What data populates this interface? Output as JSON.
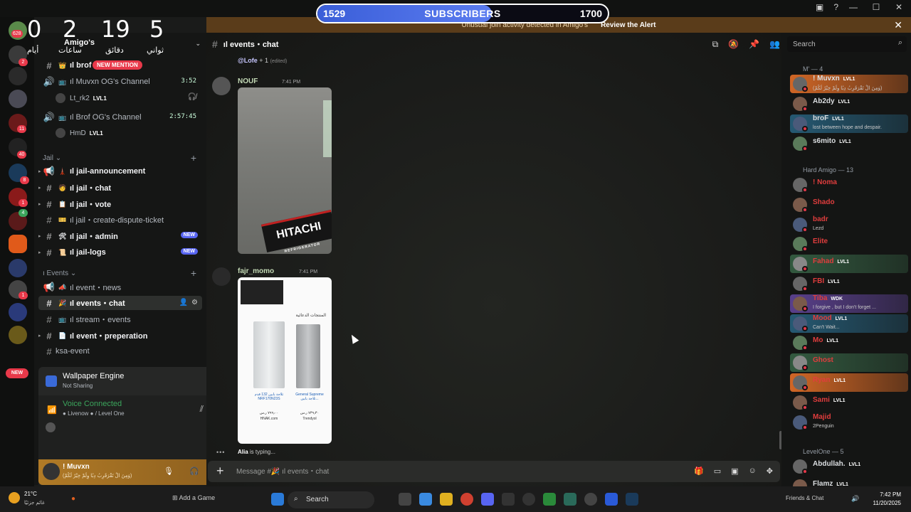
{
  "subscribers": {
    "current": "1529",
    "label": "SUBSCRIBERS",
    "goal": "1700",
    "progress": 0.6
  },
  "countdown": {
    "values": [
      "0",
      "2",
      "19",
      "5"
    ],
    "labels": [
      "أيام",
      "ساعات",
      "دقائق",
      "ثواني"
    ]
  },
  "alert": {
    "text": "Unusual join activity detected in Amigo's",
    "link": "Review the Alert"
  },
  "rail": {
    "top_badge": "628",
    "new_label": "NEW",
    "badges": [
      "2",
      "11",
      "40",
      "8",
      "1",
      "4",
      "1"
    ]
  },
  "server": {
    "name": "Amigo's"
  },
  "sidebar": {
    "mention_pill": "NEW MENTION",
    "channels_top": [
      {
        "label": "ıl brof"
      },
      {
        "label": "ıl Muvxn OG's Channel",
        "time": "3:52"
      },
      {
        "label": "ıl Brof OG's Channel",
        "time": "2:57:45"
      }
    ],
    "voice_users": [
      {
        "name": "Lt_rk2",
        "lvl": "LVL1"
      },
      {
        "name": "HmD",
        "lvl": "LVL1"
      }
    ],
    "jail_category": "Jail",
    "jail_channels": [
      {
        "label": "ıl jail-announcement",
        "emoji": "🗼"
      },
      {
        "label": "ıl jail・chat",
        "emoji": "🧑"
      },
      {
        "label": "ıl jail・vote",
        "emoji": "📋"
      },
      {
        "label": "ıl jail・create-dispute-ticket",
        "emoji": "🎫"
      },
      {
        "label": "ıl jail・admin",
        "emoji": "🛠",
        "tag": "NEW"
      },
      {
        "label": "ıl jail-logs",
        "emoji": "📜",
        "tag": "NEW"
      }
    ],
    "events_category": "ı Events",
    "events_channels": [
      {
        "label": "ıl event・news",
        "emoji": "📣"
      },
      {
        "label": "ıl events・chat",
        "emoji": "🎉"
      },
      {
        "label": "ıl stream・events",
        "emoji": "📺"
      },
      {
        "label": "ıl event・preperation",
        "emoji": "📄"
      },
      {
        "label": "ksa-event",
        "emoji": ""
      }
    ]
  },
  "wallpaper": {
    "title": "Wallpaper Engine",
    "status": "Not Sharing"
  },
  "voice": {
    "title": "Voice Connected",
    "sub1": "Livenow",
    "sub2": "/ Level One"
  },
  "user": {
    "name": "! Muvxn",
    "status": "(وَمِنَ الْ تَقْرَقَرِبُ دِبُا وِلَمْ خِيْرٌ لَكُمْ)"
  },
  "chat": {
    "channel": "ıl events・chat",
    "lofe": {
      "name": "@Lofe",
      "plus": "+ 1",
      "edited": "(edited)"
    },
    "messages": [
      {
        "author": "NOUF",
        "time": "7:41 PM"
      },
      {
        "author": "fajr_momo",
        "time": "7:41 PM"
      }
    ],
    "fridge_brand": "HITACHI",
    "fridge_sub": "REFRIGERATOR",
    "shop": {
      "heading": "المنتجات الدعائية",
      "items": [
        {
          "caption": "ثلاجة بابين 132 قدم NRF170N23S",
          "price": "٧٩٩٫٠٠ ر.س",
          "store": "HNAK.com"
        },
        {
          "caption": "General Supreme ثلاجة بابين...",
          "price": "٧٣٩٫٣٠ ر.س",
          "store": "Trendyol"
        }
      ]
    },
    "typing_user": "Alia",
    "typing_suffix": " is typing...",
    "composer_placeholder": "Message #🎉 ıl events・chat"
  },
  "members": {
    "search_placeholder": "Search",
    "groups": [
      {
        "name": "M' — 4"
      },
      {
        "name": "Hard Amigo — 13"
      },
      {
        "name": "LevelOne — 5"
      }
    ],
    "m_group": [
      {
        "name": "! Muvxn",
        "lvl": "LVL1",
        "status": "(وَمِنَ الْ تَقْرَقَرِبُ دِبُا وِلَمْ خِيْرٌ لَكُمْ)"
      },
      {
        "name": "Ab2dy",
        "lvl": "LVL1",
        "status": ""
      },
      {
        "name": "broF",
        "lvl": "LVL1",
        "status": "lost between hope and despair."
      },
      {
        "name": "s6mito",
        "lvl": "LVL1",
        "status": ""
      }
    ],
    "hard_group": [
      {
        "name": "! Noma",
        "lvl": "",
        "status": ""
      },
      {
        "name": "Shado",
        "lvl": "",
        "status": ""
      },
      {
        "name": "badr",
        "lvl": "",
        "status": "Lezd"
      },
      {
        "name": "Elite",
        "lvl": "",
        "status": ""
      },
      {
        "name": "Fahad",
        "lvl": "LVL1",
        "status": ""
      },
      {
        "name": "FBI",
        "lvl": "LVL1",
        "status": ""
      },
      {
        "name": "Tiba",
        "lvl": "WDK",
        "status": "I forgive , but I don't forget ..."
      },
      {
        "name": "Mood",
        "lvl": "LVL1",
        "status": "Can't Wait..."
      },
      {
        "name": "Mo",
        "lvl": "LVL1",
        "status": ""
      },
      {
        "name": "Ghost",
        "lvl": "",
        "status": ""
      },
      {
        "name": "Ryan",
        "lvl": "LVL1",
        "status": ""
      },
      {
        "name": "Sami",
        "lvl": "LVL1",
        "status": ""
      },
      {
        "name": "Majid",
        "lvl": "",
        "status": "2Penguin"
      }
    ],
    "level_group": [
      {
        "name": "Abdullah.",
        "lvl": "LVL1",
        "status": ""
      },
      {
        "name": "Flamz",
        "lvl": "LVL1",
        "status": ""
      }
    ]
  },
  "taskbar": {
    "weather_temp": "21°C",
    "weather_desc": "غائم جزئيًا",
    "add_game": "Add a Game",
    "search": "Search",
    "time": "7:42 PM",
    "date": "11/20/2025",
    "friends": "Friends & Chat"
  }
}
